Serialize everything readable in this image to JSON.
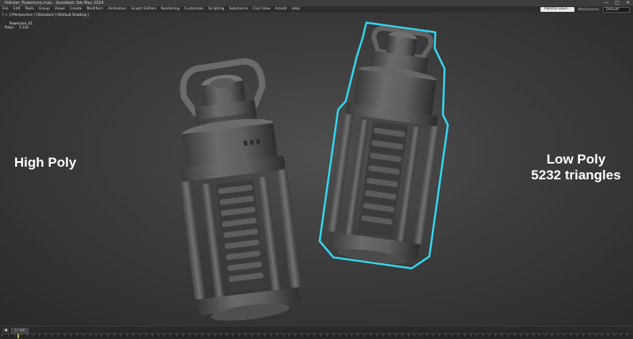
{
  "window": {
    "title": "Polluter_Powercore.max - Autodesk 3ds Max 2024",
    "controls": [
      "—",
      "□",
      "✕"
    ]
  },
  "menu": {
    "items": [
      "File",
      "Edit",
      "Tools",
      "Group",
      "Views",
      "Create",
      "Modifiers",
      "Animation",
      "Graph Editors",
      "Rendering",
      "Customize",
      "Scripting",
      "Substance",
      "Civil View",
      "Arnold",
      "Help"
    ],
    "signin_label": "Plasma Gauri...",
    "workspaces_label": "Workspaces:",
    "workspaces_value": "Default"
  },
  "viewport": {
    "label": "[ + ] [Perspective ] [Standard ] [Default Shading ]",
    "stats": [
      {
        "key": "",
        "value": "Powercore_01"
      },
      {
        "key": "Polys:",
        "value": "5 232"
      }
    ],
    "left_caption": "High Poly",
    "right_caption_line1": "Low Poly",
    "right_caption_line2": "5232 triangles",
    "selection_color": "#33d6f0",
    "model_color": "#5d5d5d"
  },
  "timeline": {
    "frame_counter": "0 / 100",
    "prev_glyph": "◀",
    "key_color": "#d8c14a"
  }
}
